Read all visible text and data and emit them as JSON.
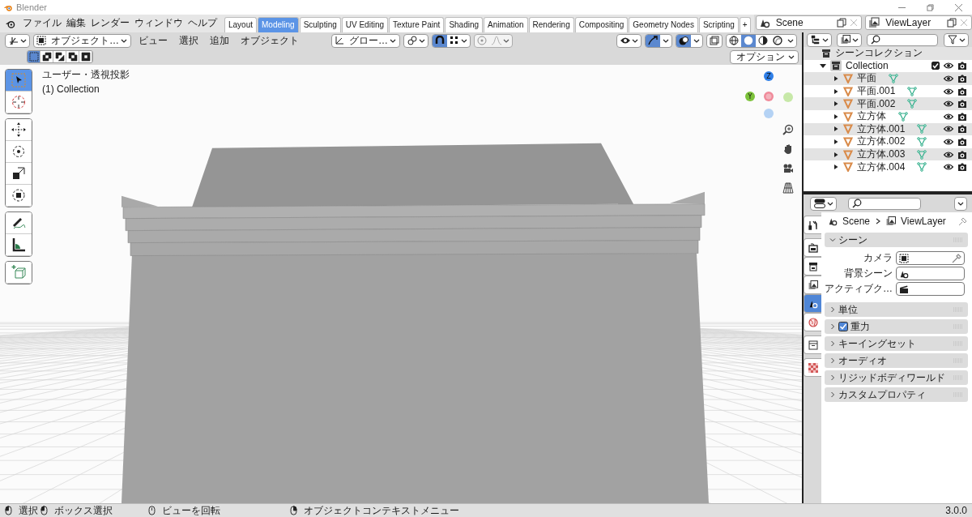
{
  "window": {
    "title": "Blender"
  },
  "menu": [
    "ファイル",
    "編集",
    "レンダー",
    "ウィンドウ",
    "ヘルプ"
  ],
  "workspaces": [
    {
      "label": "Layout",
      "selected": false
    },
    {
      "label": "Modeling",
      "selected": true
    },
    {
      "label": "Sculpting",
      "selected": false
    },
    {
      "label": "UV Editing",
      "selected": false
    },
    {
      "label": "Texture Paint",
      "selected": false
    },
    {
      "label": "Shading",
      "selected": false
    },
    {
      "label": "Animation",
      "selected": false
    },
    {
      "label": "Rendering",
      "selected": false
    },
    {
      "label": "Compositing",
      "selected": false
    },
    {
      "label": "Geometry Nodes",
      "selected": false
    },
    {
      "label": "Scripting",
      "selected": false
    }
  ],
  "add_tab": "+",
  "scene": {
    "value": "Scene"
  },
  "view_layer": {
    "value": "ViewLayer"
  },
  "viewport": {
    "mode": "オブジェクト…",
    "menus": [
      "ビュー",
      "選択",
      "追加",
      "オブジェクト"
    ],
    "orientation": "グロー…",
    "snap_on": true,
    "gizmos_on": true,
    "overlays_on": true,
    "xray_on": false,
    "shading": [
      {
        "kind": "wireframe",
        "selected": false
      },
      {
        "kind": "solid",
        "selected": true
      },
      {
        "kind": "material",
        "selected": false
      },
      {
        "kind": "rendered",
        "selected": false
      }
    ],
    "select_modes": [
      {
        "selected": true
      },
      {
        "selected": false
      },
      {
        "selected": false
      },
      {
        "selected": false
      },
      {
        "selected": false
      }
    ],
    "options": "オプション",
    "view_name": "ユーザー・透視投影",
    "collection_label": "(1) Collection",
    "tool_groups": [
      [
        {
          "kind": "select",
          "selected": true
        },
        {
          "kind": "cursor",
          "selected": false
        }
      ],
      [
        {
          "kind": "move",
          "selected": false
        },
        {
          "kind": "rotate",
          "selected": false
        },
        {
          "kind": "scale",
          "selected": false
        },
        {
          "kind": "transform",
          "selected": false
        }
      ],
      [
        {
          "kind": "annotate",
          "selected": false
        },
        {
          "kind": "measure",
          "selected": false
        }
      ],
      [
        {
          "kind": "add_cube",
          "selected": false
        }
      ]
    ],
    "gizmo_axes": [
      {
        "label": "Z"
      },
      {
        "label": "Y"
      }
    ]
  },
  "outliner": {
    "title": "シーンコレクション",
    "collections": [
      {
        "name": "Collection",
        "checked": true,
        "expanded": true,
        "children": [
          {
            "name": "平面",
            "expanded": false
          },
          {
            "name": "平面.001",
            "expanded": false
          },
          {
            "name": "平面.002",
            "expanded": false
          },
          {
            "name": "立方体",
            "expanded": false
          },
          {
            "name": "立方体.001",
            "expanded": false
          },
          {
            "name": "立方体.002",
            "expanded": false
          },
          {
            "name": "立方体.003",
            "expanded": false
          },
          {
            "name": "立方体.004",
            "expanded": false
          }
        ]
      }
    ]
  },
  "properties": {
    "breadcrumb": [
      "Scene",
      "ViewLayer"
    ],
    "tabs": [
      {
        "kind": "tool",
        "selected": false
      },
      {
        "kind": "render",
        "selected": false
      },
      {
        "kind": "output",
        "selected": false
      },
      {
        "kind": "view_layer",
        "selected": false
      },
      {
        "kind": "scene",
        "selected": true
      },
      {
        "kind": "world",
        "selected": false
      },
      {
        "kind": "collection",
        "selected": false
      },
      {
        "kind": "texture",
        "selected": false
      }
    ],
    "panels": [
      {
        "title": "シーン",
        "kind": "plain",
        "expanded": true,
        "fields": [
          {
            "label": "カメラ",
            "kind": "camera"
          },
          {
            "label": "背景シーン",
            "kind": "scene"
          },
          {
            "label": "アクティブク…",
            "kind": "clip"
          }
        ]
      },
      {
        "title": "単位",
        "kind": "plain",
        "expanded": false
      },
      {
        "title": "重力",
        "kind": "toggle",
        "checked": true,
        "expanded": false
      },
      {
        "title": "キーイングセット",
        "kind": "plain",
        "expanded": false
      },
      {
        "title": "オーディオ",
        "kind": "plain",
        "expanded": false
      },
      {
        "title": "リジッドボディワールド",
        "kind": "plain",
        "expanded": false
      },
      {
        "title": "カスタムプロパティ",
        "kind": "plain",
        "expanded": false
      }
    ]
  },
  "status_bar": {
    "hints": [
      "選択",
      "ボックス選択",
      "ビューを回転",
      "オブジェクトコンテキストメニュー"
    ],
    "version": "3.0.0"
  }
}
